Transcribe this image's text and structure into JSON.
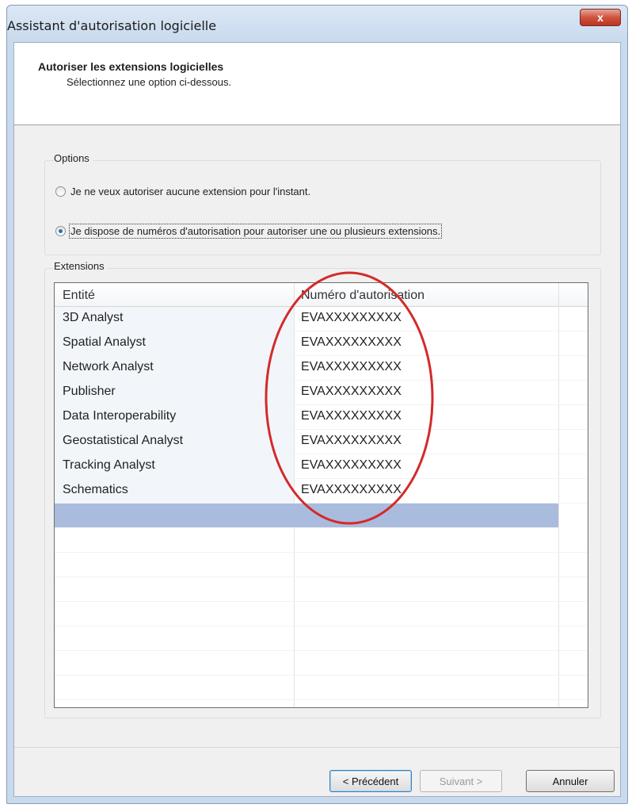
{
  "window": {
    "title": "Assistant d'autorisation logicielle",
    "close_label": "x"
  },
  "header": {
    "title": "Autoriser les extensions logicielles",
    "subtitle": "Sélectionnez une option ci-dessous."
  },
  "options": {
    "group_label": "Options",
    "radio_none": "Je ne veux autoriser aucune extension pour l'instant.",
    "radio_have_numbers": "Je dispose de numéros d'autorisation pour autoriser une ou plusieurs extensions.",
    "selected": "radio_have_numbers"
  },
  "extensions": {
    "group_label": "Extensions",
    "columns": [
      "Entité",
      "Numéro d'autorisation"
    ],
    "rows": [
      {
        "entity": "3D Analyst",
        "code": "EVAXXXXXXXXX"
      },
      {
        "entity": "Spatial Analyst",
        "code": "EVAXXXXXXXXX"
      },
      {
        "entity": "Network Analyst",
        "code": "EVAXXXXXXXXX"
      },
      {
        "entity": "Publisher",
        "code": "EVAXXXXXXXXX"
      },
      {
        "entity": "Data Interoperability",
        "code": "EVAXXXXXXXXX"
      },
      {
        "entity": "Geostatistical Analyst",
        "code": "EVAXXXXXXXXX"
      },
      {
        "entity": "Tracking Analyst",
        "code": "EVAXXXXXXXXX"
      },
      {
        "entity": "Schematics",
        "code": "EVAXXXXXXXXX"
      }
    ]
  },
  "buttons": {
    "previous": "< Précédent",
    "next": "Suivant >",
    "cancel": "Annuler"
  },
  "colors": {
    "annotation_circle": "#d42a2a",
    "selected_row": "#a9bcde"
  }
}
